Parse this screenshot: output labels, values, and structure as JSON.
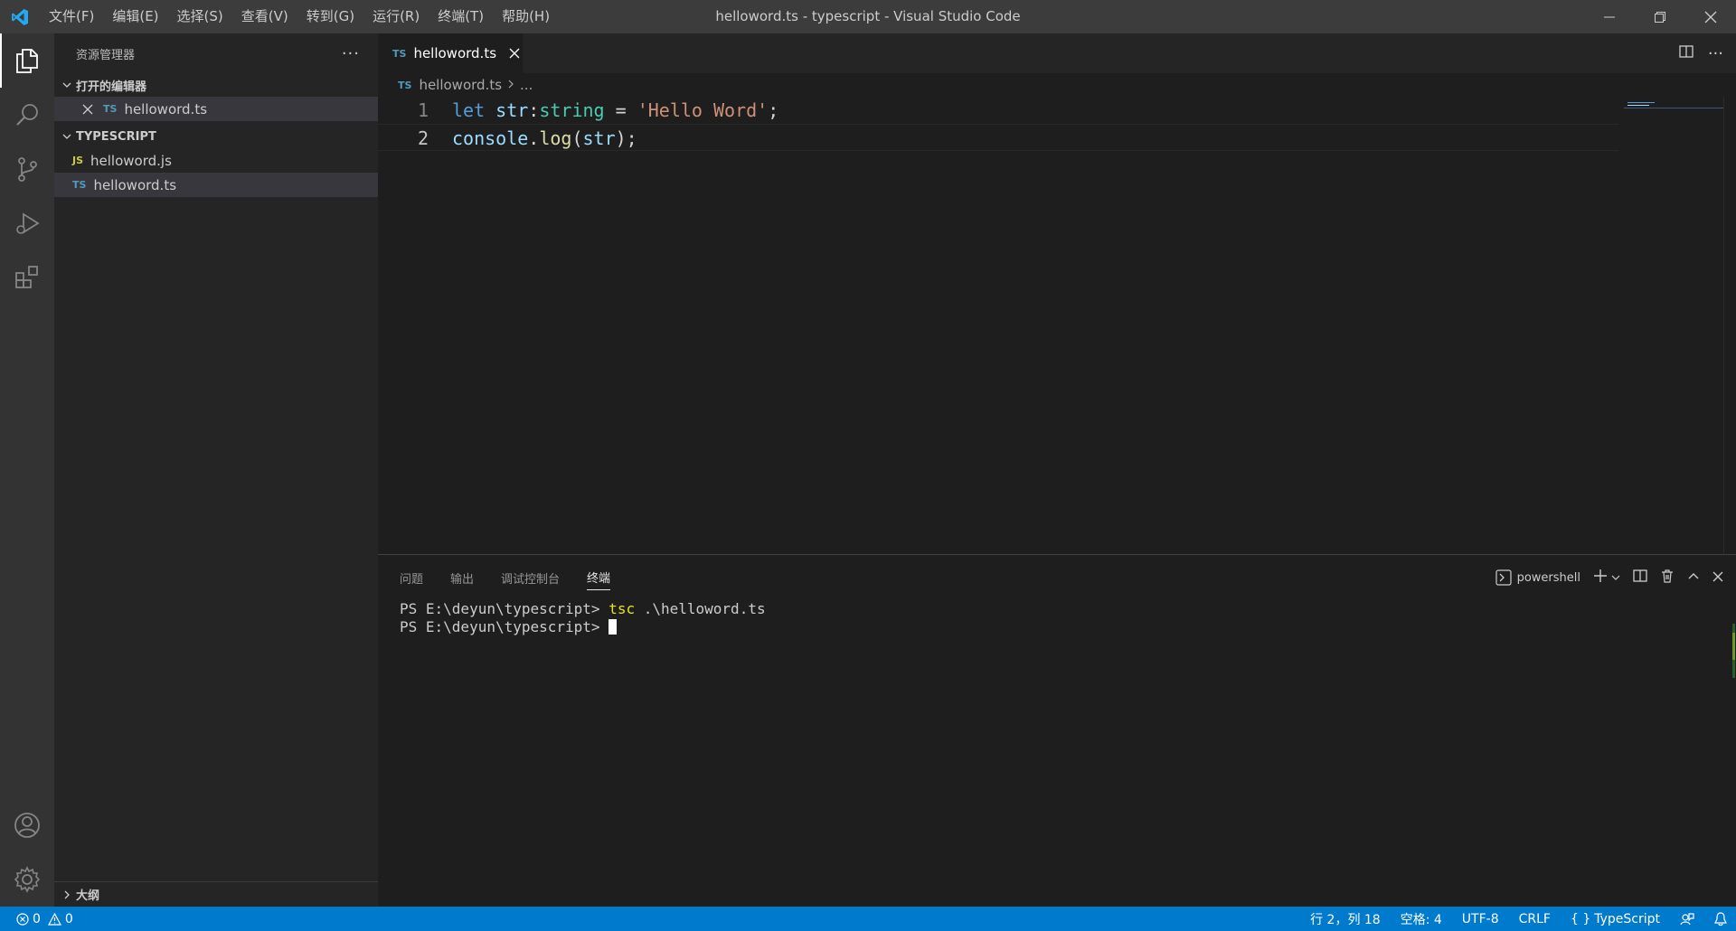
{
  "window": {
    "title": "helloword.ts - typescript - Visual Studio Code"
  },
  "menu": [
    "文件(F)",
    "编辑(E)",
    "选择(S)",
    "查看(V)",
    "转到(G)",
    "运行(R)",
    "终端(T)",
    "帮助(H)"
  ],
  "sidebar": {
    "title": "资源管理器",
    "open_editors": {
      "label": "打开的编辑器",
      "items": [
        {
          "tag": "TS",
          "name": "helloword.ts"
        }
      ]
    },
    "folder": {
      "label": "TYPESCRIPT",
      "items": [
        {
          "tag": "JS",
          "name": "helloword.js"
        },
        {
          "tag": "TS",
          "name": "helloword.ts"
        }
      ]
    },
    "outline_label": "大纲"
  },
  "editor": {
    "tab": {
      "tag": "TS",
      "name": "helloword.ts"
    },
    "breadcrumb": {
      "tag": "TS",
      "file": "helloword.ts",
      "rest": "..."
    },
    "lines": [
      {
        "num": "1",
        "tokens": [
          [
            "kw",
            "let"
          ],
          [
            "plain",
            " "
          ],
          [
            "var",
            "str"
          ],
          [
            "plain",
            ":"
          ],
          [
            "type",
            "string"
          ],
          [
            "plain",
            " = "
          ],
          [
            "str",
            "'Hello Word'"
          ],
          [
            "plain",
            ";"
          ]
        ]
      },
      {
        "num": "2",
        "tokens": [
          [
            "var",
            "console"
          ],
          [
            "plain",
            "."
          ],
          [
            "fn",
            "log"
          ],
          [
            "plain",
            "("
          ],
          [
            "var",
            "str"
          ],
          [
            "plain",
            ");"
          ]
        ]
      }
    ]
  },
  "panel": {
    "tabs": [
      "问题",
      "输出",
      "调试控制台",
      "终端"
    ],
    "active_tab": "终端",
    "shell": "powershell",
    "terminal": {
      "line1_prompt": "PS E:\\deyun\\typescript> ",
      "line1_cmd": "tsc",
      "line1_rest": " .\\helloword.ts",
      "line2_prompt": "PS E:\\deyun\\typescript> "
    }
  },
  "statusbar": {
    "errors": "0",
    "warnings": "0",
    "position": "行 2，列 18",
    "indent": "空格: 4",
    "encoding": "UTF-8",
    "eol": "CRLF",
    "language": "TypeScript",
    "language_icon": "{ }"
  },
  "colors": {
    "accent": "#007acc",
    "activity_bar": "#333333",
    "sidebar": "#252526",
    "editor": "#1e1e1e",
    "titlebar": "#3c3c3c"
  }
}
